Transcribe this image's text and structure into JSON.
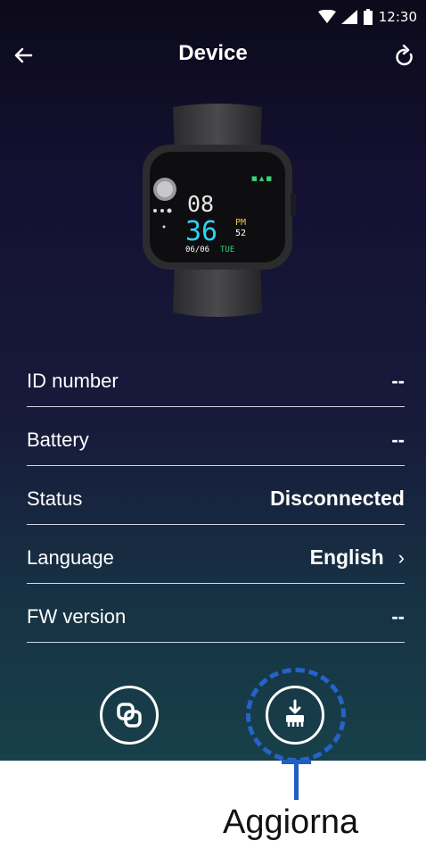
{
  "status_bar": {
    "time": "12:30"
  },
  "header": {
    "title": "Device"
  },
  "watch_face": {
    "hour": "08",
    "minute": "36",
    "ampm": "PM",
    "seconds": "52",
    "date": "06/06",
    "day": "TUE"
  },
  "rows": [
    {
      "label": "ID number",
      "value": "--"
    },
    {
      "label": "Battery",
      "value": "--"
    },
    {
      "label": "Status",
      "value": "Disconnected"
    },
    {
      "label": "Language",
      "value": "English"
    },
    {
      "label": "FW version",
      "value": "--"
    }
  ],
  "callout": {
    "label": "Aggiorna"
  },
  "colors": {
    "accent": "#2563c9",
    "background_top": "#0c0a1a",
    "background_bottom": "#17404a"
  }
}
